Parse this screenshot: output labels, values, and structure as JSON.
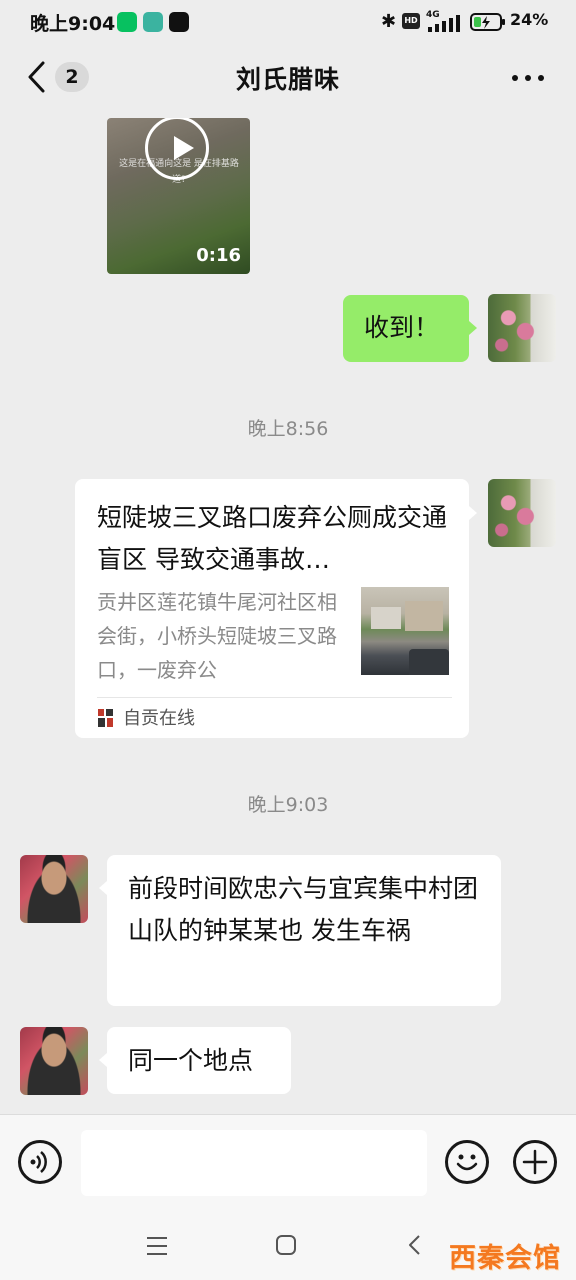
{
  "status_bar": {
    "time": "晚上9:04",
    "network": "4G",
    "hd": "HD",
    "battery": "24%"
  },
  "header": {
    "unread_count": "2",
    "title": "刘氏腊味"
  },
  "messages": {
    "video": {
      "overlay_text": "这是在福通向这是\n是在排基路道?",
      "duration": "0:16"
    },
    "received_reply": "收到！",
    "time_1": "晚上8:56",
    "link_card": {
      "title": "短陡坡三叉路口废弃公厕成交通盲区  导致交通事故…",
      "description": "贡井区莲花镇牛尾河社区相会街，小桥头短陡坡三叉路口，一废弃公",
      "source": "自贡在线"
    },
    "time_2": "晚上9:03",
    "msg_1": "前段时间欧忠六与宜宾集中村团山队的钟某某也  发生车祸",
    "msg_2": "同一个地点"
  },
  "input_bar": {
    "placeholder": "",
    "value": ""
  },
  "watermark": "西秦会馆",
  "icons": {
    "voice": "voice-icon",
    "emoji": "emoji-icon",
    "add": "plus-icon",
    "back": "back-arrow-icon",
    "more": "more-dots-icon"
  },
  "colors": {
    "sent_bubble": "#95ec69",
    "received_bubble": "#ffffff",
    "background": "#ededed",
    "watermark": "#f47920"
  }
}
